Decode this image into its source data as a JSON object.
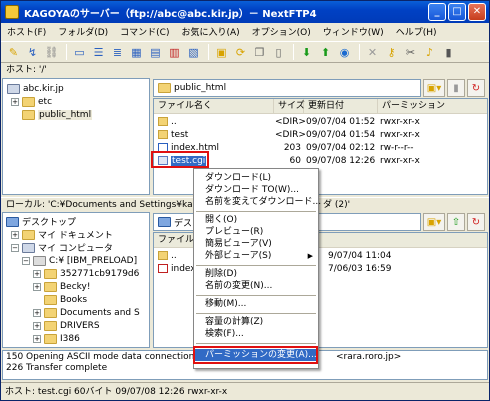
{
  "window": {
    "title": "KAGOYAのサーバー（ftp://abc@abc.kir.jp）－ NextFTP4",
    "minimize": "_",
    "maximize": "□",
    "close": "✕"
  },
  "menu": [
    "ホスト(F)",
    "フォルダ(D)",
    "コマンド(C)",
    "お気に入り(A)",
    "オプション(O)",
    "ウィンドウ(W)",
    "ヘルプ(H)"
  ],
  "toolbar_icons": [
    "connect-icon",
    "edit-icon",
    "disconnect-icon",
    "view-icon",
    "list-icon",
    "detail-icon",
    "icons-icon",
    "table-icon",
    "html-icon",
    "calendar-icon",
    "folder-icon",
    "refresh-icon",
    "copy-icon",
    "paste-icon",
    "download-icon",
    "upload-icon",
    "globe-icon",
    "delete-icon",
    "key-icon",
    "cut-icon",
    "bell-icon",
    "chart-icon"
  ],
  "host_label": "ホスト: '/'",
  "remote_tree": {
    "root": "abc.kir.jp",
    "items": [
      "etc",
      "public_html"
    ]
  },
  "remote_path": "public_html",
  "remote_columns": [
    "ファイル名く",
    "サイズ",
    "更新日付",
    "パーミッション"
  ],
  "remote_files": [
    {
      "name": "..",
      "size": "",
      "date": "",
      "perm": ""
    },
    {
      "name": "test",
      "size": "<DIR>",
      "date": "09/07/04 01:54",
      "perm": "rwxr-xr-x"
    },
    {
      "name": "index.html",
      "size": "203",
      "date": "09/07/04 02:12",
      "perm": "rw-r--r--"
    },
    {
      "name": "test.cgi",
      "size": "60",
      "date": "09/07/08 12:26",
      "perm": "rwxr-xr-x"
    }
  ],
  "top_dir_row": {
    "size": "<DIR>",
    "date": "09/07/04 01:52",
    "perm": "rwxr-xr-x"
  },
  "local_label": "ローカル: 'C:¥Documents and Settings¥kagoya¥ﾃﾞｽｸﾄｯﾌﾟ¥...ﾀﾞ (2)'",
  "local_label_start": "ローカル: 'C:¥Documents and Settings¥kagoya",
  "local_label_end": "ダ (2)'",
  "local_tree": {
    "items": [
      "デスクトップ",
      "マイ ドキュメント",
      "マイ コンピュータ",
      "C:¥ [IBM_PRELOAD]",
      "352771cb9179d6",
      "Becky!",
      "Books",
      "Documents and S",
      "DRIVERS",
      "I386"
    ]
  },
  "local_path": "デス",
  "local_columns": [
    "ファイル名"
  ],
  "local_files": [
    {
      "name": "..",
      "date": "9/07/04 11:04"
    },
    {
      "name": "index",
      "date": "7/06/03 16:59"
    }
  ],
  "log_lines": [
    "150 Opening ASCII mode data connection for f",
    "226 Transfer complete"
  ],
  "log_right": "<rara.roro.jp>",
  "status_text": "ホスト: test.cgi  60バイト  09/07/08 12:26  rwxr-xr-x",
  "context_menu": [
    "ダウンロード(L)",
    "ダウンロード TO(W)...",
    "名前を変えてダウンロード...",
    "開く(O)",
    "プレビュー(R)",
    "簡易ビューア(V)",
    "外部ビューア(S)",
    "削除(D)",
    "名前の変更(N)...",
    "移動(M)...",
    "容量の計算(Z)",
    "検索(F)...",
    "パーミッションの変更(A)..."
  ]
}
